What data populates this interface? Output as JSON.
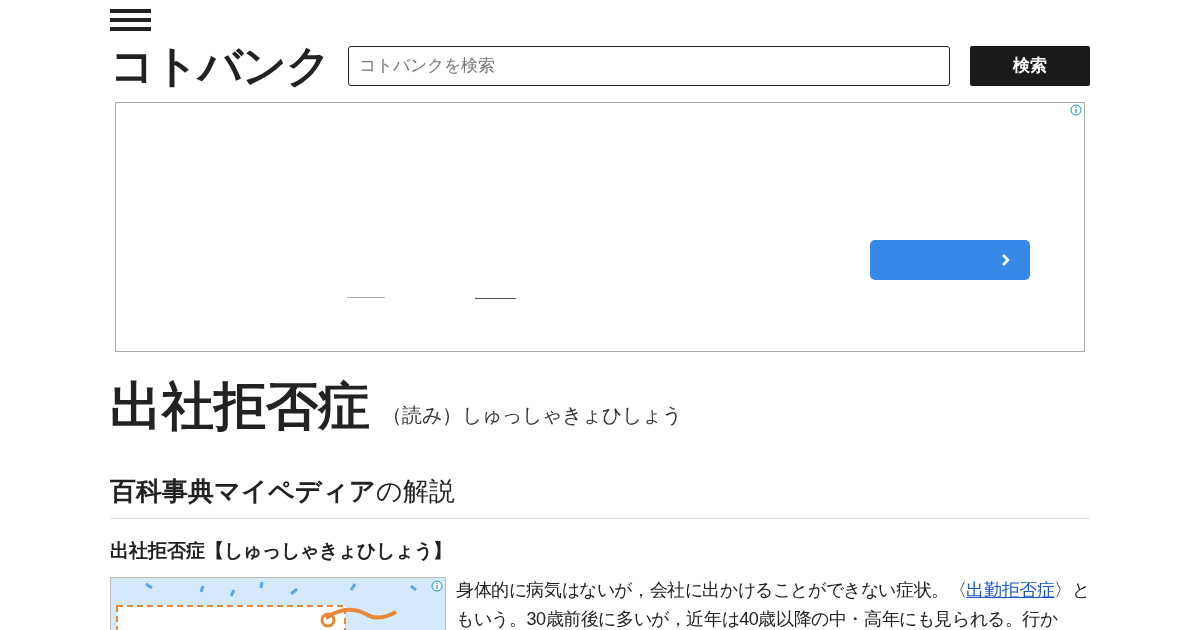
{
  "header": {
    "logo": "コトバンク",
    "search": {
      "placeholder": "コトバンクを検索"
    },
    "search_button": "検索"
  },
  "ad": {
    "kind": "banner"
  },
  "entry": {
    "title": "出社拒否症",
    "reading": "（読み）しゅっしゃきょひしょう"
  },
  "section": {
    "heading": "**百科事典マイペディア**の解説",
    "subheading": "出社拒否症【しゅっしゃきょひしょう】",
    "paragraph": [
      {
        "kind": "text",
        "text": "身体的に病気はないが，会社に出かけることができない症状。〈"
      },
      {
        "kind": "link",
        "text": "出勤拒否症"
      },
      {
        "kind": "text",
        "text": "〉ともいう。30歳前後に多いが，近年は40歳以降の中・高年にも見られる。行か"
      }
    ]
  }
}
